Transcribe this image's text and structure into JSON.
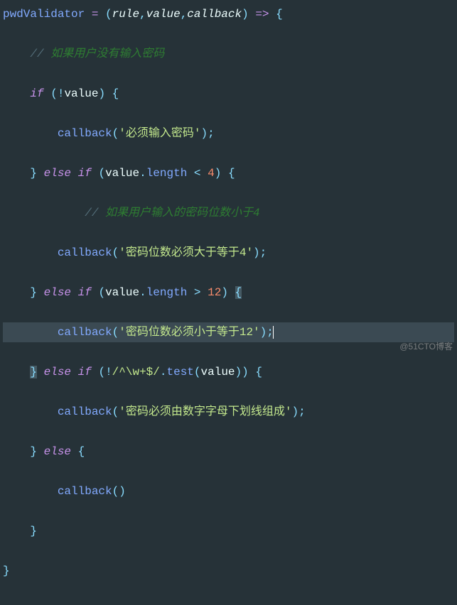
{
  "code": {
    "fn_name": "pwdValidator",
    "params": [
      "rule",
      "value",
      "callback"
    ],
    "comment1_prefix": "// ",
    "comment1_text": "如果用户没有输入密码",
    "kw_if": "if",
    "kw_else": "else",
    "cond1": "!value",
    "call_cb": "callback",
    "str1": "'必须输入密码'",
    "cond2_obj": "value",
    "cond2_prop": "length",
    "cond2_op": "<",
    "cond2_num": "4",
    "comment2_prefix": "// ",
    "comment2_text": "如果用户输入的密码位数小于4",
    "str2": "'密码位数必须大于等于4'",
    "cond3_op": ">",
    "cond3_num": "12",
    "str3": "'密码位数必须小于等于12'",
    "cond4_regex": "/^\\w+$/",
    "cond4_method": "test",
    "cond4_arg": "value",
    "str4": "'密码必须由数字字母下划线组成'"
  },
  "watermark": "@51CTO博客",
  "chart_data": null
}
